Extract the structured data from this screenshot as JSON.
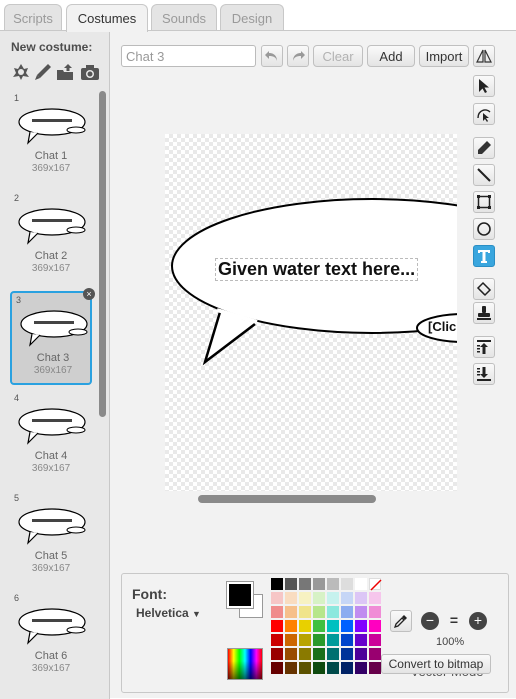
{
  "tabs": [
    {
      "label": "Scripts",
      "active": false
    },
    {
      "label": "Costumes",
      "active": true
    },
    {
      "label": "Sounds",
      "active": false
    },
    {
      "label": "Design",
      "active": false
    }
  ],
  "new_costume": {
    "label": "New costume:",
    "icons": [
      "paint-from-library-icon",
      "paint-new-icon",
      "upload-icon",
      "camera-icon"
    ]
  },
  "costumes": [
    {
      "number": "1",
      "name": "Chat 1",
      "size": "369x167",
      "selected": false
    },
    {
      "number": "2",
      "name": "Chat 2",
      "size": "369x167",
      "selected": false
    },
    {
      "number": "3",
      "name": "Chat 3",
      "size": "369x167",
      "selected": true
    },
    {
      "number": "4",
      "name": "Chat 4",
      "size": "369x167",
      "selected": false
    },
    {
      "number": "5",
      "name": "Chat 5",
      "size": "369x167",
      "selected": false
    },
    {
      "number": "6",
      "name": "Chat 6",
      "size": "369x167",
      "selected": false
    }
  ],
  "delete_glyph": "×",
  "toolbar": {
    "costume_name_value": "Chat 3",
    "clear_label": "Clear",
    "add_label": "Add",
    "import_label": "Import"
  },
  "canvas": {
    "bubble_text": "Given water text here...",
    "secondary_text": "[Click"
  },
  "font": {
    "label": "Font:",
    "selected": "Helvetica"
  },
  "colors": {
    "primary": "#000000",
    "secondary": "#ffffff",
    "selection_accent": "#2aa1e0"
  },
  "zoom": {
    "level": "100%"
  },
  "mode": {
    "label": "Vector Mode",
    "convert_label": "Convert to bitmap"
  }
}
